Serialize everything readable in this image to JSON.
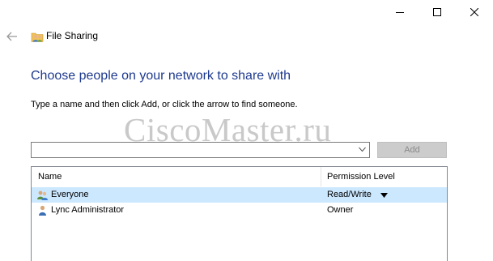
{
  "window": {
    "title": "File Sharing",
    "controls": [
      "minimize-icon",
      "maximize-icon",
      "close-icon"
    ]
  },
  "main": {
    "heading": "Choose people on your network to share with",
    "instruction": "Type a name and then click Add, or click the arrow to find someone.",
    "watermark": "CiscoMaster.ru",
    "name_input": {
      "value": "",
      "placeholder": ""
    },
    "add_button": "Add"
  },
  "list": {
    "headers": {
      "name": "Name",
      "permission": "Permission Level"
    },
    "rows": [
      {
        "name": "Everyone",
        "permission": "Read/Write",
        "icon": "group-users-icon",
        "selected": true,
        "has_dropdown": true
      },
      {
        "name": "Lync Administrator",
        "permission": "Owner",
        "icon": "user-icon",
        "selected": false,
        "has_dropdown": false
      }
    ]
  },
  "colors": {
    "heading": "#1e3a8f",
    "selection": "#cce8ff",
    "button_disabled_bg": "#cccccc",
    "button_disabled_text": "#8a8a8a"
  }
}
